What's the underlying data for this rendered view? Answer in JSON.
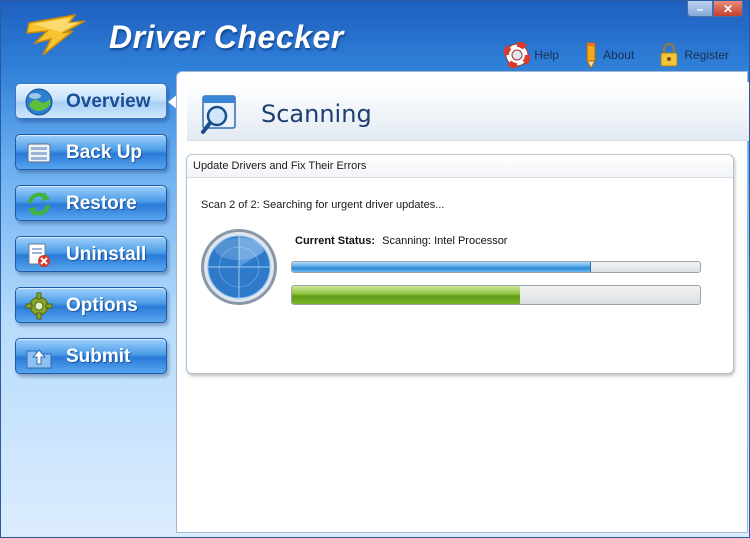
{
  "app": {
    "title": "Driver Checker"
  },
  "window_controls": {
    "minimize": "–",
    "close": "✕"
  },
  "top_links": [
    {
      "label": "Help",
      "icon": "lifebuoy-icon"
    },
    {
      "label": "About",
      "icon": "pencil-icon"
    },
    {
      "label": "Register",
      "icon": "lock-icon"
    }
  ],
  "sidebar": {
    "items": [
      {
        "label": "Overview",
        "icon": "globe-icon",
        "active": true
      },
      {
        "label": "Back Up",
        "icon": "backup-icon",
        "active": false
      },
      {
        "label": "Restore",
        "icon": "restore-arrows-icon",
        "active": false
      },
      {
        "label": "Uninstall",
        "icon": "uninstall-icon",
        "active": false
      },
      {
        "label": "Options",
        "icon": "gear-icon",
        "active": false
      },
      {
        "label": "Submit",
        "icon": "folder-upload-icon",
        "active": false
      }
    ]
  },
  "main": {
    "title": "Scanning",
    "title_icon": "magnifier-window-icon",
    "group": {
      "title": "Update Drivers and Fix Their Errors",
      "scan_step": "Scan 2 of 2: Searching for urgent driver updates...",
      "status_label": "Current Status:",
      "status_value": "Scanning:  Intel Processor",
      "primary_progress": 0.73,
      "overall_progress": 0.56
    }
  },
  "colors": {
    "accent": "#2b7ad8",
    "progress_blue": "#4aa0e2",
    "progress_green": "#8dc23b",
    "title_text": "#1d3f70"
  }
}
